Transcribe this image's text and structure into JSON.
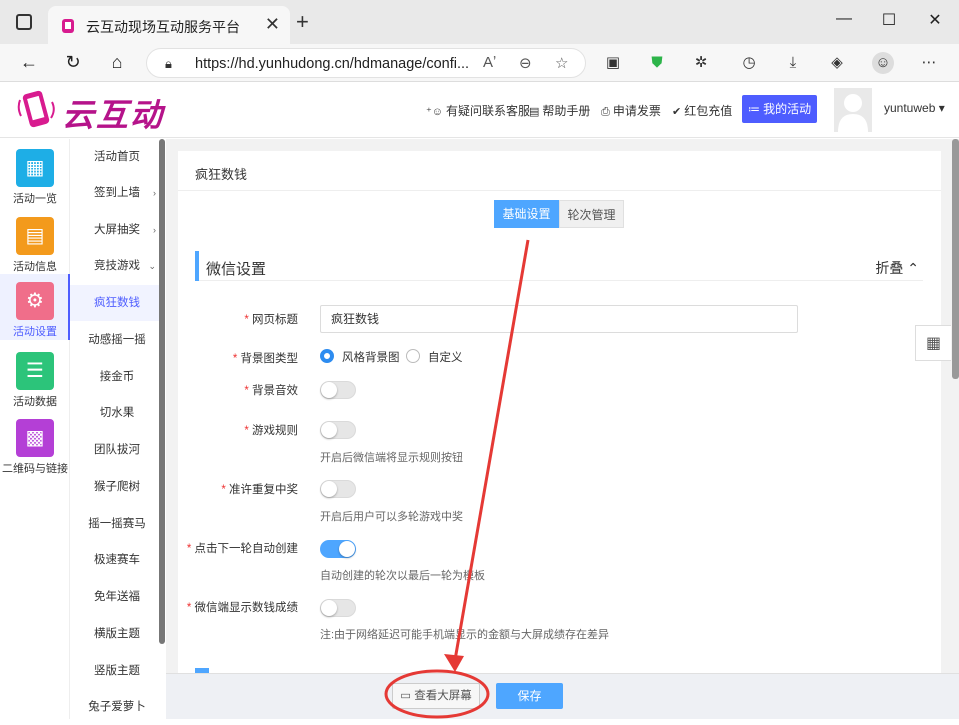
{
  "browser": {
    "tab_title": "云互动现场互动服务平台",
    "url": "https://hd.yunhudong.cn/hdmanage/confi..."
  },
  "header": {
    "logo_text": "云互动",
    "links": [
      "有疑问联系客服",
      "帮助手册",
      "申请发票",
      "红包充值"
    ],
    "my_activity": "我的活动",
    "username": "yuntuweb"
  },
  "sidebar1": {
    "items": [
      {
        "label": "活动一览",
        "icon": "grid-icon",
        "color": "#1eaee6"
      },
      {
        "label": "活动信息",
        "icon": "document-icon",
        "color": "#f39a1c"
      },
      {
        "label": "活动设置",
        "icon": "gear-icon",
        "color": "#f06e8a"
      },
      {
        "label": "活动数据",
        "icon": "database-icon",
        "color": "#2cc47a"
      },
      {
        "label": "二维码与链接",
        "icon": "qrcode-icon",
        "color": "#b43fd6"
      }
    ]
  },
  "sidebar2": {
    "items": [
      "活动首页",
      "签到上墙",
      "大屏抽奖",
      "竞技游戏",
      "疯狂数钱",
      "动感摇一摇",
      "接金币",
      "切水果",
      "团队拔河",
      "猴子爬树",
      "摇一摇赛马",
      "极速赛车",
      "免年送福",
      "横版主题",
      "竖版主题",
      "兔子爱萝卜"
    ]
  },
  "main": {
    "page_title": "疯狂数钱",
    "tabs": [
      "基础设置",
      "轮次管理"
    ],
    "section_title": "微信设置",
    "fold_label": "折叠",
    "fields": {
      "page_title_label": "网页标题",
      "page_title_value": "疯狂数钱",
      "bg_type_label": "背景图类型",
      "bg_option1": "风格背景图",
      "bg_option2": "自定义",
      "bg_sound_label": "背景音效",
      "game_rules_label": "游戏规则",
      "game_rules_hint": "开启后微信端将显示规则按钮",
      "repeat_win_label": "准许重复中奖",
      "repeat_win_hint": "开启后用户可以多轮游戏中奖",
      "auto_create_label": "点击下一轮自动创建",
      "auto_create_hint": "自动创建的轮次以最后一轮为模板",
      "wechat_score_label": "微信端显示数钱成绩",
      "wechat_score_hint": "注:由于网络延迟可能手机端显示的金额与大屏成绩存在差异"
    }
  },
  "footer": {
    "view_screen": "查看大屏幕",
    "save": "保存"
  },
  "colors": {
    "accent": "#4e5dff",
    "primary_blue": "#4ea6ff",
    "annotation_red": "#e53935"
  }
}
